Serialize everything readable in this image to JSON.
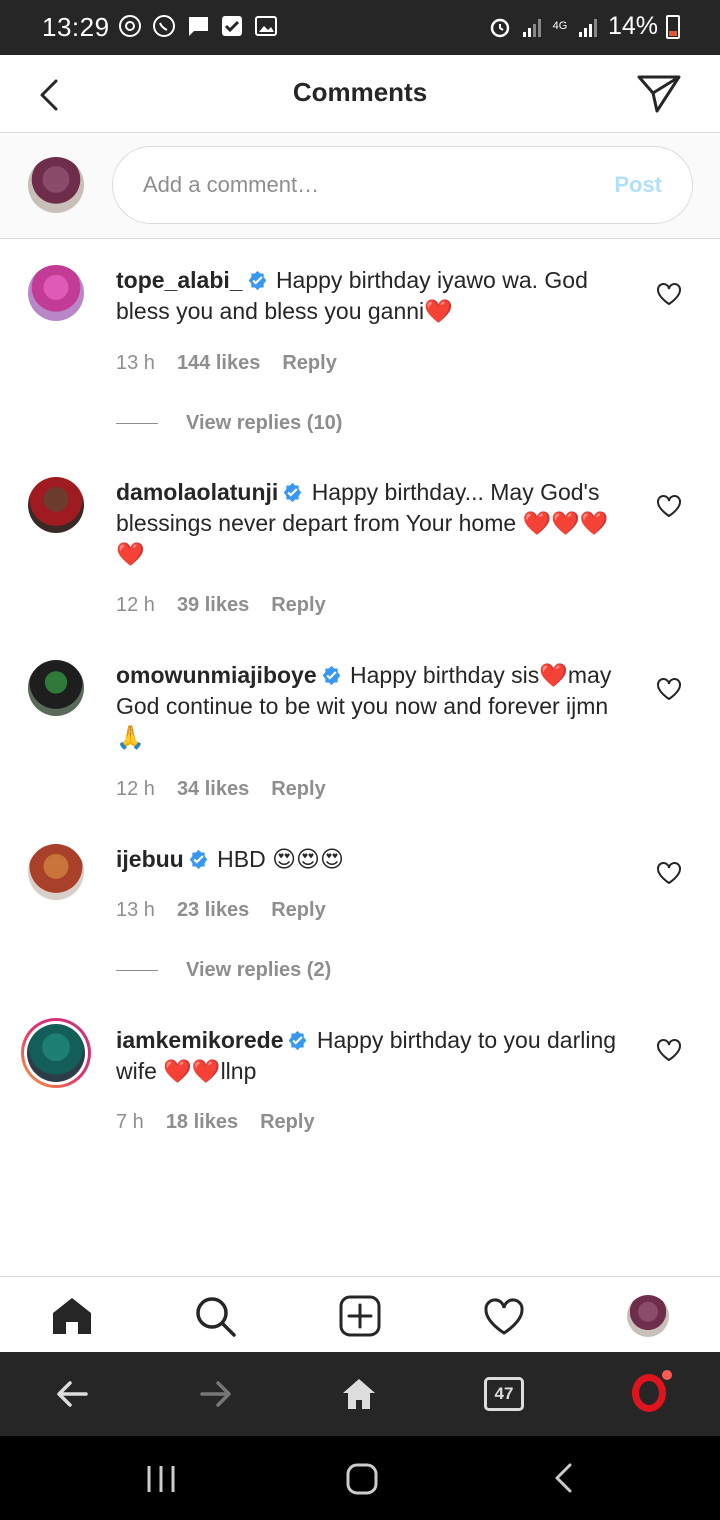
{
  "status_bar": {
    "time": "13:29",
    "network": "4G",
    "battery": "14%",
    "left_icons": [
      "at-sign-icon",
      "whatsapp-icon",
      "message-icon",
      "check-box-icon",
      "image-icon"
    ],
    "right_icons": [
      "alarm-icon",
      "signal-icon",
      "signal-icon",
      "battery-icon"
    ]
  },
  "header": {
    "title": "Comments",
    "back_icon": "chevron-left-icon",
    "send_icon": "paper-plane-icon"
  },
  "composer": {
    "placeholder": "Add a comment…",
    "post_label": "Post",
    "post_color": "#b2dffc"
  },
  "comments": [
    {
      "username": "tope_alabi_",
      "verified": true,
      "text": "Happy birthday iyawo wa. God bless you and bless you ganni❤️",
      "time": "13 h",
      "likes": "144 likes",
      "reply": "Reply",
      "view_replies": "View replies (10)"
    },
    {
      "username": "damolaolatunji",
      "verified": true,
      "text": "Happy birthday... May God's blessings never depart from Your home ❤️❤️❤️❤️",
      "time": "12 h",
      "likes": "39 likes",
      "reply": "Reply"
    },
    {
      "username": "omowunmiajiboye",
      "verified": true,
      "text": "Happy birthday sis❤️may God continue to be wit you now and forever ijmn🙏",
      "time": "12 h",
      "likes": "34 likes",
      "reply": "Reply"
    },
    {
      "username": "ijebuu",
      "verified": true,
      "text": "HBD 😍😍😍",
      "time": "13 h",
      "likes": "23 likes",
      "reply": "Reply",
      "view_replies": "View replies (2)"
    },
    {
      "username": "iamkemikorede",
      "verified": true,
      "has_story_ring": true,
      "text": "Happy birthday to you darling wife ❤️❤️llnp",
      "time": "7 h",
      "likes": "18 likes",
      "reply": "Reply"
    }
  ],
  "bottom_nav": [
    "home-icon",
    "search-icon",
    "new-post-icon",
    "activity-heart-icon",
    "profile-avatar"
  ],
  "browser_bar": {
    "tab_count": "47",
    "icons": [
      "back-arrow-icon",
      "forward-arrow-icon",
      "home-icon",
      "tabs-icon",
      "opera-icon"
    ]
  },
  "android_nav": [
    "recents-icon",
    "home-icon",
    "back-icon"
  ],
  "colors": {
    "verified_blue": "#3897f0",
    "meta_gray": "#8e8e8e",
    "text": "#262626",
    "status_bar_bg": "#262626"
  }
}
